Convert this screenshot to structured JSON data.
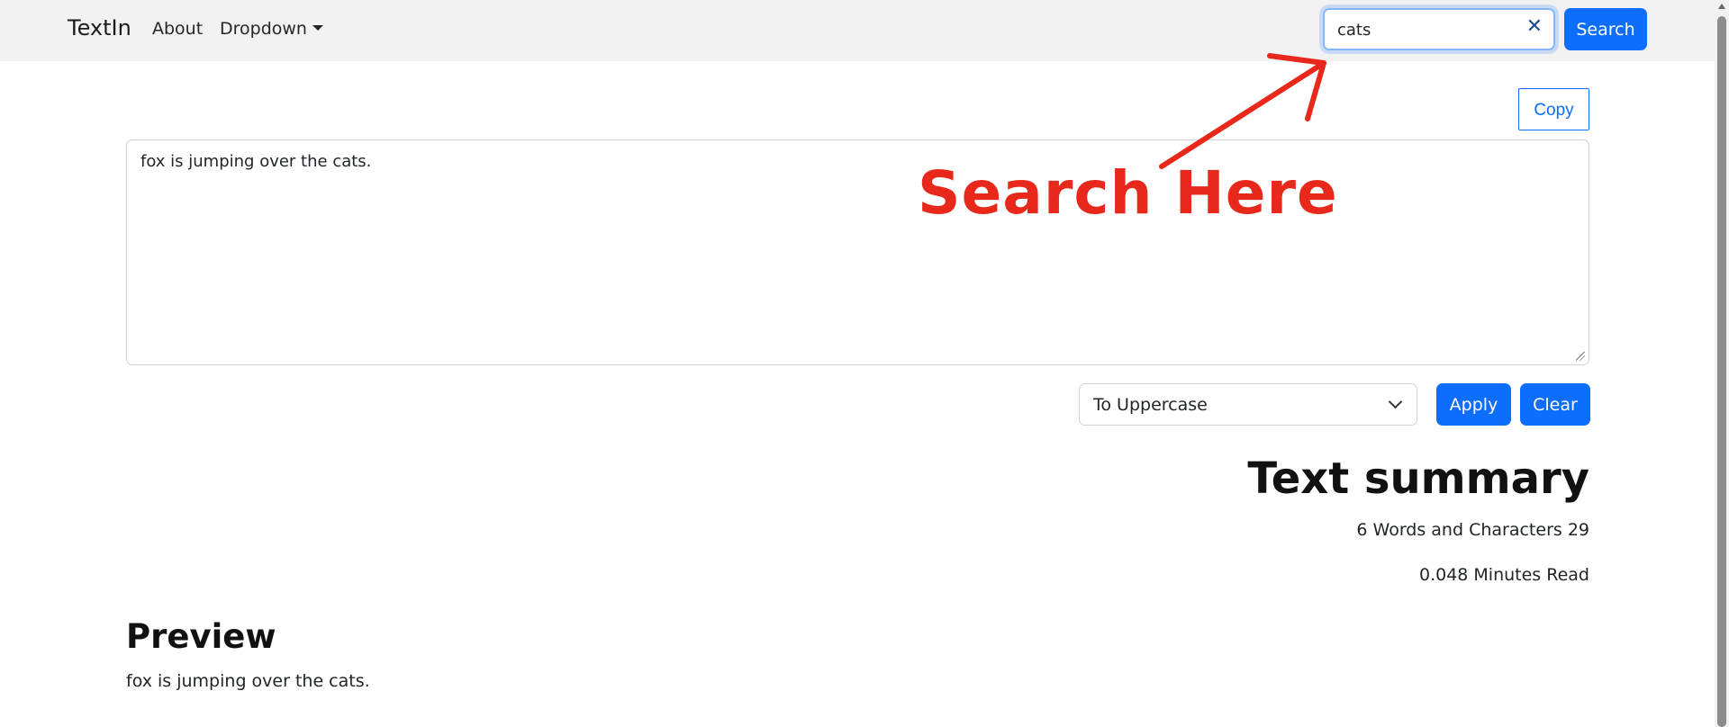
{
  "navbar": {
    "brand": "TextIn",
    "links": [
      "About",
      "Dropdown"
    ],
    "search": {
      "value": "cats",
      "button_label": "Search"
    }
  },
  "editor": {
    "copy_label": "Copy",
    "text": "fox is jumping over the cats.",
    "transform": {
      "selected": "To Uppercase"
    },
    "apply_label": "Apply",
    "clear_label": "Clear"
  },
  "summary": {
    "title": "Text summary",
    "counts": "6 Words and Characters 29",
    "read_time": "0.048 Minutes Read"
  },
  "preview": {
    "title": "Preview",
    "text": "fox is jumping over the cats."
  },
  "annotation": {
    "label": "Search Here",
    "color": "#e8281b"
  },
  "colors": {
    "primary": "#0d6efd",
    "navbar_bg": "#f2f2f2"
  }
}
